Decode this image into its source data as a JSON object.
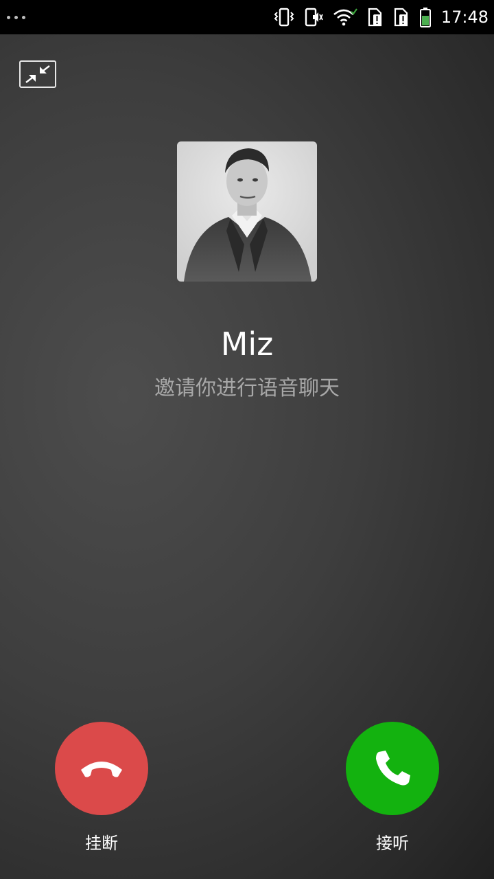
{
  "status_bar": {
    "time": "17:48",
    "icons": [
      "more-dots-icon",
      "vibrate-icon",
      "speaker-mute-icon",
      "wifi-icon",
      "sim-alert-icon",
      "sim-alert-icon-2",
      "battery-icon"
    ]
  },
  "call": {
    "caller_name": "Miz",
    "status_text": "邀请你进行语音聊天"
  },
  "actions": {
    "hangup_label": "挂断",
    "answer_label": "接听"
  },
  "colors": {
    "hangup": "#db4a4a",
    "answer": "#13b20f",
    "background": "#3e3e3e"
  }
}
